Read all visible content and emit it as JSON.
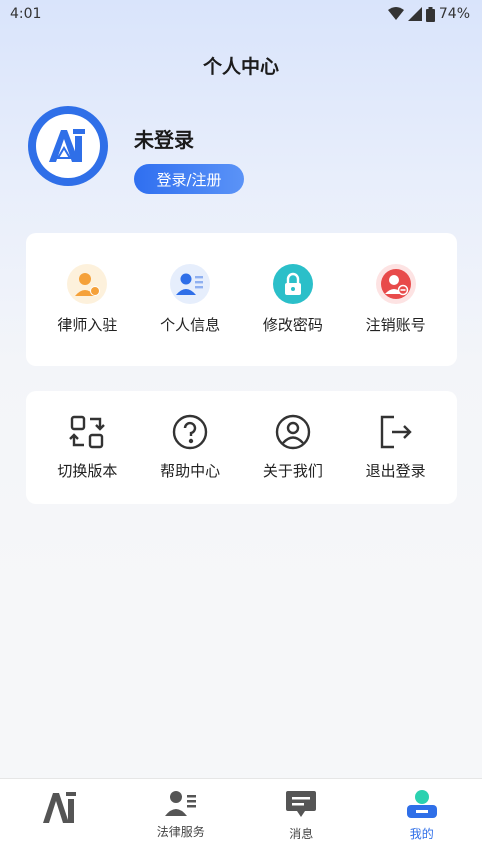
{
  "status": {
    "time": "4:01",
    "battery": "74%"
  },
  "header": {
    "title": "个人中心"
  },
  "profile": {
    "name": "未登录",
    "login_label": "登录/注册"
  },
  "section1": [
    {
      "label": "律师入驻",
      "icon": "lawyer-join-icon"
    },
    {
      "label": "个人信息",
      "icon": "personal-info-icon"
    },
    {
      "label": "修改密码",
      "icon": "lock-icon"
    },
    {
      "label": "注销账号",
      "icon": "cancel-account-icon"
    }
  ],
  "section2": [
    {
      "label": "切换版本",
      "icon": "switch-version-icon"
    },
    {
      "label": "帮助中心",
      "icon": "help-icon"
    },
    {
      "label": "关于我们",
      "icon": "about-icon"
    },
    {
      "label": "退出登录",
      "icon": "logout-icon"
    }
  ],
  "tabs": [
    {
      "label": "",
      "icon": "ai-logo-icon"
    },
    {
      "label": "法律服务",
      "icon": "legal-service-icon"
    },
    {
      "label": "消息",
      "icon": "message-icon"
    },
    {
      "label": "我的",
      "icon": "profile-icon",
      "active": true
    }
  ],
  "colors": {
    "accent": "#2f6fe8",
    "danger": "#e84a4a",
    "teal": "#2bbfc9",
    "orange": "#f5a13a"
  }
}
